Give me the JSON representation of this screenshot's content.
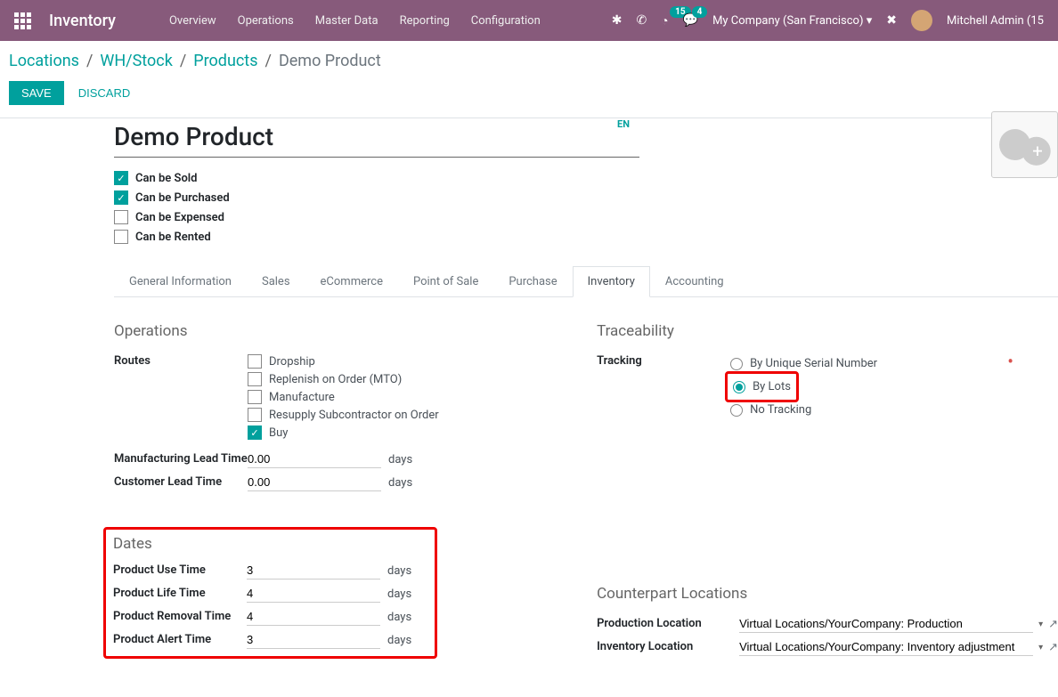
{
  "topbar": {
    "app_title": "Inventory",
    "nav": [
      "Overview",
      "Operations",
      "Master Data",
      "Reporting",
      "Configuration"
    ],
    "badge_clock": "15",
    "badge_chat": "4",
    "company": "My Company (San Francisco)",
    "user": "Mitchell Admin (15"
  },
  "breadcrumb": {
    "items": [
      "Locations",
      "WH/Stock",
      "Products"
    ],
    "current": "Demo Product"
  },
  "actions": {
    "save": "SAVE",
    "discard": "DISCARD"
  },
  "product": {
    "title": "Demo Product",
    "lang": "EN",
    "flags": {
      "sold": {
        "label": "Can be Sold",
        "checked": true
      },
      "purchased": {
        "label": "Can be Purchased",
        "checked": true
      },
      "expensed": {
        "label": "Can be Expensed",
        "checked": false
      },
      "rented": {
        "label": "Can be Rented",
        "checked": false
      }
    }
  },
  "tabs": [
    "General Information",
    "Sales",
    "eCommerce",
    "Point of Sale",
    "Purchase",
    "Inventory",
    "Accounting"
  ],
  "operations": {
    "title": "Operations",
    "routes_label": "Routes",
    "routes": [
      {
        "label": "Dropship",
        "checked": false
      },
      {
        "label": "Replenish on Order (MTO)",
        "checked": false
      },
      {
        "label": "Manufacture",
        "checked": false
      },
      {
        "label": "Resupply Subcontractor on Order",
        "checked": false
      },
      {
        "label": "Buy",
        "checked": true
      }
    ],
    "mfg_lead_label": "Manufacturing Lead Time",
    "mfg_lead_val": "0.00",
    "cust_lead_label": "Customer Lead Time",
    "cust_lead_val": "0.00",
    "days": "days"
  },
  "trace": {
    "title": "Traceability",
    "tracking_label": "Tracking",
    "options": {
      "serial": "By Unique Serial Number",
      "lots": "By Lots",
      "none": "No Tracking"
    }
  },
  "dates": {
    "title": "Dates",
    "use_label": "Product Use Time",
    "use_val": "3",
    "life_label": "Product Life Time",
    "life_val": "4",
    "removal_label": "Product Removal Time",
    "removal_val": "4",
    "alert_label": "Product Alert Time",
    "alert_val": "3",
    "days": "days"
  },
  "counterpart": {
    "title": "Counterpart Locations",
    "prod_label": "Production Location",
    "prod_val": "Virtual Locations/YourCompany: Production",
    "inv_label": "Inventory Location",
    "inv_val": "Virtual Locations/YourCompany: Inventory adjustment"
  }
}
